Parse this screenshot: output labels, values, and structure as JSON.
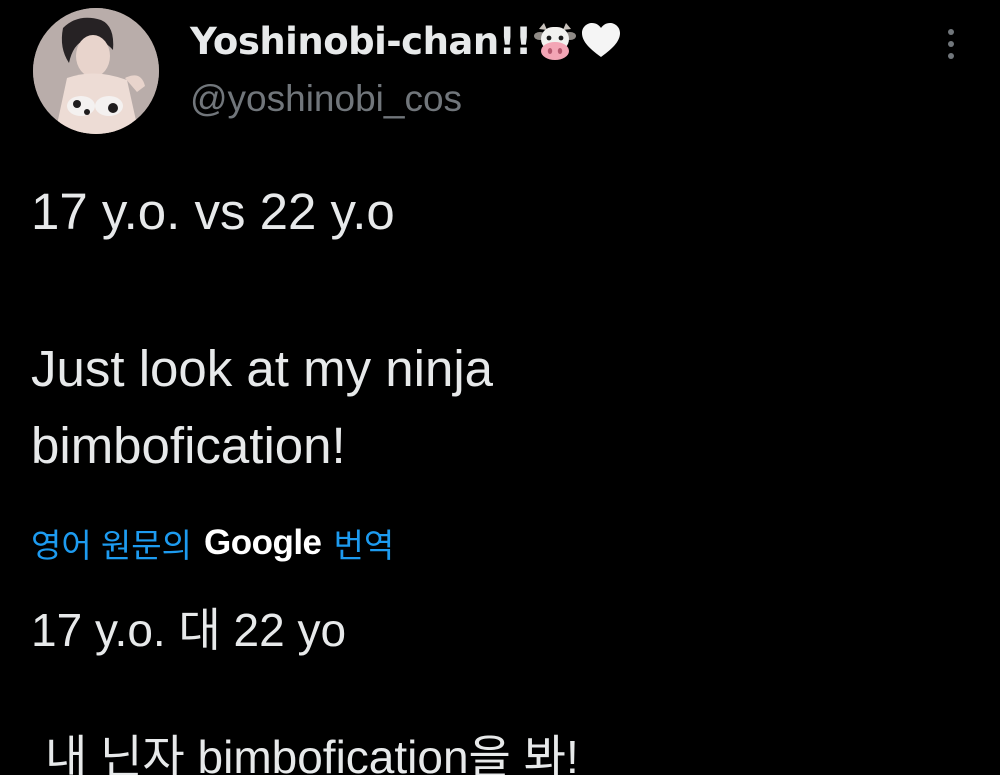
{
  "user": {
    "display_name": "Yoshinobi-chan!!",
    "handle": "@yoshinobi_cos",
    "name_emojis": [
      "cow-face-icon",
      "white-heart-icon"
    ]
  },
  "tweet": {
    "lines": [
      "17 y.o. vs 22 y.o",
      "Just look at my ninja",
      "bimbofication!"
    ]
  },
  "translation": {
    "prefix": "영어 원문의",
    "brand": "Google",
    "suffix": "번역",
    "lines": [
      "17 y.o. 대 22 yo",
      "내 닌자 bimbofication을 봐!"
    ]
  },
  "colors": {
    "background": "#000000",
    "text": "#e7e9ea",
    "secondary": "#71767b",
    "link": "#1d9bf0"
  }
}
